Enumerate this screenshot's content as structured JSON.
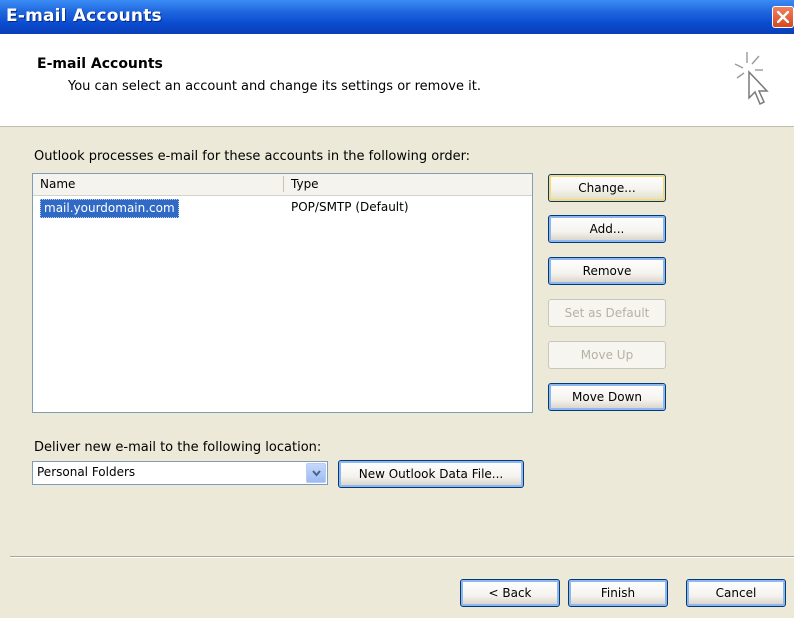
{
  "window": {
    "title": "E-mail Accounts",
    "close_icon": "close-icon"
  },
  "header": {
    "title": "E-mail Accounts",
    "subtitle": "You can select an account and change its settings or remove it.",
    "icon": "wizard-cursor-icon"
  },
  "accounts": {
    "instruction": "Outlook processes e-mail for these accounts in the following order:",
    "columns": [
      "Name",
      "Type"
    ],
    "rows": [
      {
        "name": "mail.yourdomain.com",
        "type": "POP/SMTP (Default)",
        "selected": true
      }
    ]
  },
  "side_buttons": {
    "change": "Change...",
    "add": "Add...",
    "remove": "Remove",
    "set_default": "Set as Default",
    "move_up": "Move Up",
    "move_down": "Move Down"
  },
  "delivery": {
    "label": "Deliver new e-mail to the following location:",
    "selected": "Personal Folders",
    "new_data_file": "New Outlook Data File..."
  },
  "footer": {
    "back": "< Back",
    "finish": "Finish",
    "cancel": "Cancel"
  },
  "colors": {
    "titlebar": "#0a4bd0",
    "selection": "#316ac5",
    "dialog_bg": "#ece9d8"
  }
}
